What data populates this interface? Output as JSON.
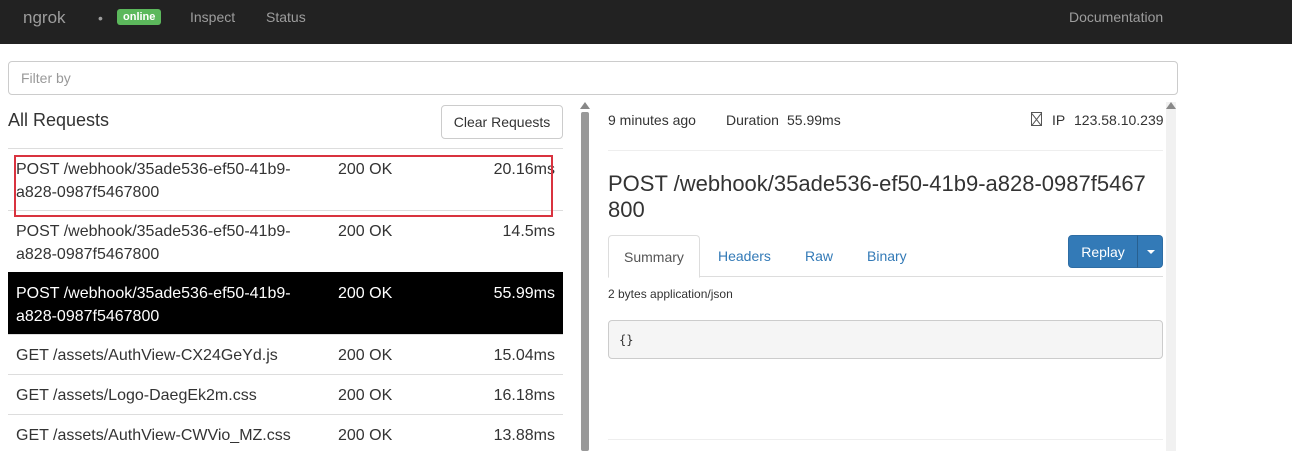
{
  "navbar": {
    "brand": "ngrok",
    "dot": "•",
    "badge": "online",
    "links": [
      "Inspect",
      "Status"
    ],
    "docs": "Documentation"
  },
  "filter": {
    "placeholder": "Filter by",
    "value": ""
  },
  "requests": {
    "title": "All Requests",
    "clear_label": "Clear Requests",
    "rows": [
      {
        "path": "POST /webhook/35ade536-ef50-41b9-a828-0987f5467800",
        "status": "200 OK",
        "duration": "20.16ms"
      },
      {
        "path": "POST /webhook/35ade536-ef50-41b9-a828-0987f5467800",
        "status": "200 OK",
        "duration": "14.5ms"
      },
      {
        "path": "POST /webhook/35ade536-ef50-41b9-a828-0987f5467800",
        "status": "200 OK",
        "duration": "55.99ms"
      },
      {
        "path": "GET /assets/AuthView-CX24GeYd.js",
        "status": "200 OK",
        "duration": "15.04ms"
      },
      {
        "path": "GET /assets/Logo-DaegEk2m.css",
        "status": "200 OK",
        "duration": "16.18ms"
      },
      {
        "path": "GET /assets/AuthView-CWVio_MZ.css",
        "status": "200 OK",
        "duration": "13.88ms"
      }
    ]
  },
  "detail": {
    "time_ago": "9 minutes ago",
    "duration_label": "Duration",
    "duration_value": "55.99ms",
    "ip_label": "IP",
    "ip_value": "123.58.10.239",
    "title": "POST /webhook/35ade536-ef50-41b9-a828-0987f5467800",
    "tabs": [
      "Summary",
      "Headers",
      "Raw",
      "Binary"
    ],
    "replay_label": "Replay",
    "body_info": "2 bytes application/json",
    "body": "{}"
  },
  "colors": {
    "navbar": "#222222",
    "badge": "#5cb85c",
    "link": "#337ab7",
    "selected_row": "#000000",
    "highlight": "#d9333f"
  }
}
